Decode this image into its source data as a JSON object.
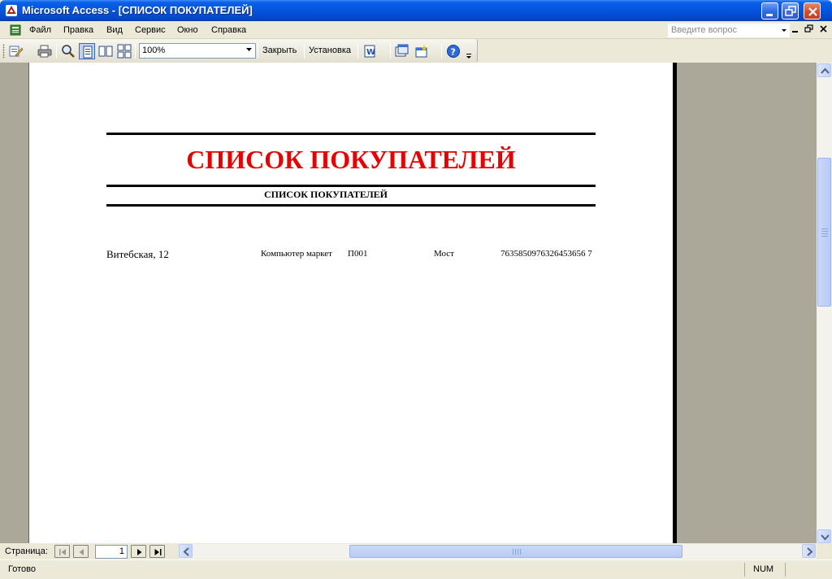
{
  "window": {
    "title": "Microsoft Access - [СПИСОК ПОКУПАТЕЛЕЙ]"
  },
  "menu": {
    "items": [
      "Файл",
      "Правка",
      "Вид",
      "Сервис",
      "Окно",
      "Справка"
    ],
    "help_placeholder": "Введите вопрос"
  },
  "toolbar": {
    "zoom": "100%",
    "close_label": "Закрыть",
    "setup_label": "Установка"
  },
  "report": {
    "title": "СПИСОК ПОКУПАТЕЛЕЙ",
    "subtitle": "СПИСОК ПОКУПАТЕЛЕЙ",
    "rows": [
      {
        "address": "Витебская, 12",
        "company": "Компьютер маркет",
        "code": "П001",
        "bank": "Мост",
        "account": "7635850976326453656 7"
      }
    ]
  },
  "navigation": {
    "label": "Страница:",
    "page_number": "1"
  },
  "status": {
    "text": "Готово",
    "num_indicator": "NUM"
  },
  "colors": {
    "title_red": "#e80000",
    "titlebar_blue": "#0555de",
    "workspace_gray": "#aca899"
  }
}
